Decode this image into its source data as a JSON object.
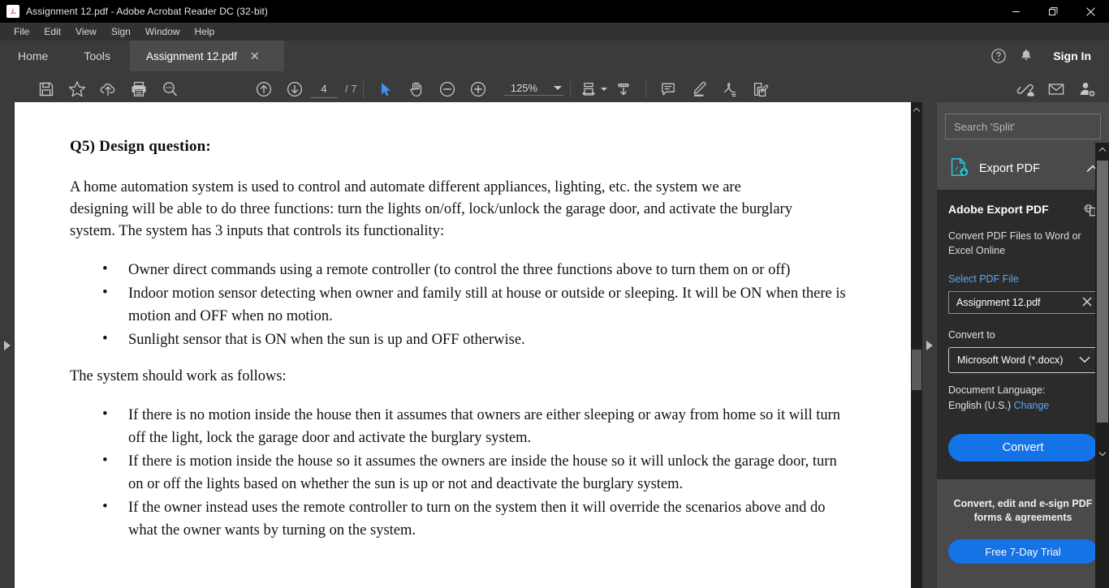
{
  "window": {
    "title": "Assignment 12.pdf - Adobe Acrobat Reader DC (32-bit)",
    "app_icon": "acrobat-icon",
    "controls": {
      "minimize": "—",
      "restore": "❐",
      "close": "✕"
    }
  },
  "menubar": {
    "items": [
      "File",
      "Edit",
      "View",
      "Sign",
      "Window",
      "Help"
    ]
  },
  "tabbar": {
    "home": "Home",
    "tools": "Tools",
    "document_tab": {
      "label": "Assignment 12.pdf",
      "close": "✕"
    },
    "help_icon": "help-circle-icon",
    "bell_icon": "notification-bell-icon",
    "signin": "Sign In"
  },
  "toolbar": {
    "save_icon": "save-icon",
    "star_icon": "add-to-favorites-star-icon",
    "cloud_icon": "save-to-cloud-icon",
    "print_icon": "print-icon",
    "find_icon": "find-text-icon",
    "prev_page_icon": "previous-page-icon",
    "next_page_icon": "next-page-icon",
    "page_current": "4",
    "page_total": "/ 7",
    "select_tool_icon": "select-cursor-icon",
    "hand_tool_icon": "hand-pan-icon",
    "zoom_out_icon": "zoom-out-icon",
    "zoom_in_icon": "zoom-in-icon",
    "zoom_level": "125%",
    "fit_page_icon": "fit-page-icon",
    "scroll_mode_icon": "scroll-mode-icon",
    "comment_icon": "add-comment-icon",
    "highlight_icon": "highlight-text-icon",
    "draw_icon": "draw-signature-icon",
    "fill_sign_icon": "fill-and-sign-icon",
    "share_link_icon": "share-link-icon",
    "email_icon": "email-icon",
    "add_person_icon": "invite-people-icon",
    "accent_color": "#3d95f5"
  },
  "rails": {
    "left_expand_icon": "expand-left-panel-icon",
    "right_expand_icon": "expand-right-panel-icon"
  },
  "document": {
    "heading": "Q5) Design question:",
    "intro": "A home automation system is used to control and automate different appliances, lighting, etc. the system we are designing will be able to do three functions: turn the lights on/off, lock/unlock the garage door, and activate the burglary system. The system has 3 inputs that controls its functionality:",
    "inputs": [
      "Owner direct commands using a remote controller (to control the three functions above to turn them on or off)",
      "Indoor motion sensor detecting when owner and family still at house or outside or sleeping. It will be ON when there is motion and OFF when no motion.",
      "Sunlight sensor that is ON when the sun is up and OFF otherwise."
    ],
    "works_as_follows": "The system should work as follows:",
    "rules": [
      "If there is no motion inside the house then it assumes that owners are either sleeping or away from home so it will turn off the light, lock the garage door and activate the burglary system.",
      "If there is motion inside the house so it assumes the owners are inside the house so it will unlock the garage door, turn on or off the lights based on whether the sun is up or not and deactivate the burglary system.",
      "If the owner instead uses the remote controller to turn on the system then it will override the scenarios above and do what the owner wants by turning on the system."
    ]
  },
  "sidebar": {
    "search_placeholder": "Search 'Split'",
    "panel": {
      "icon": "export-pdf-icon",
      "title": "Export PDF",
      "collapse_icon": "chevron-up-icon"
    },
    "export": {
      "heading": "Adobe Export PDF",
      "copy_icon": "online-service-icon",
      "subtitle": "Convert PDF Files to Word or Excel Online",
      "select_file_label": "Select PDF File",
      "file_name": "Assignment 12.pdf",
      "file_clear_icon": "clear-file-icon",
      "convert_to_label": "Convert to",
      "convert_to_value": "Microsoft Word (*.docx)",
      "convert_to_caret": "chevron-down-icon",
      "doc_language_label": "Document Language:",
      "doc_language_value": "English (U.S.)",
      "doc_language_change": "Change",
      "convert_button": "Convert",
      "accent_color": "#1473e6"
    },
    "promo": {
      "text": "Convert, edit and e-sign PDF forms & agreements",
      "button": "Free 7-Day Trial"
    },
    "scrollbar": {
      "up_icon": "scroll-up-icon",
      "down_icon": "scroll-down-icon"
    }
  }
}
